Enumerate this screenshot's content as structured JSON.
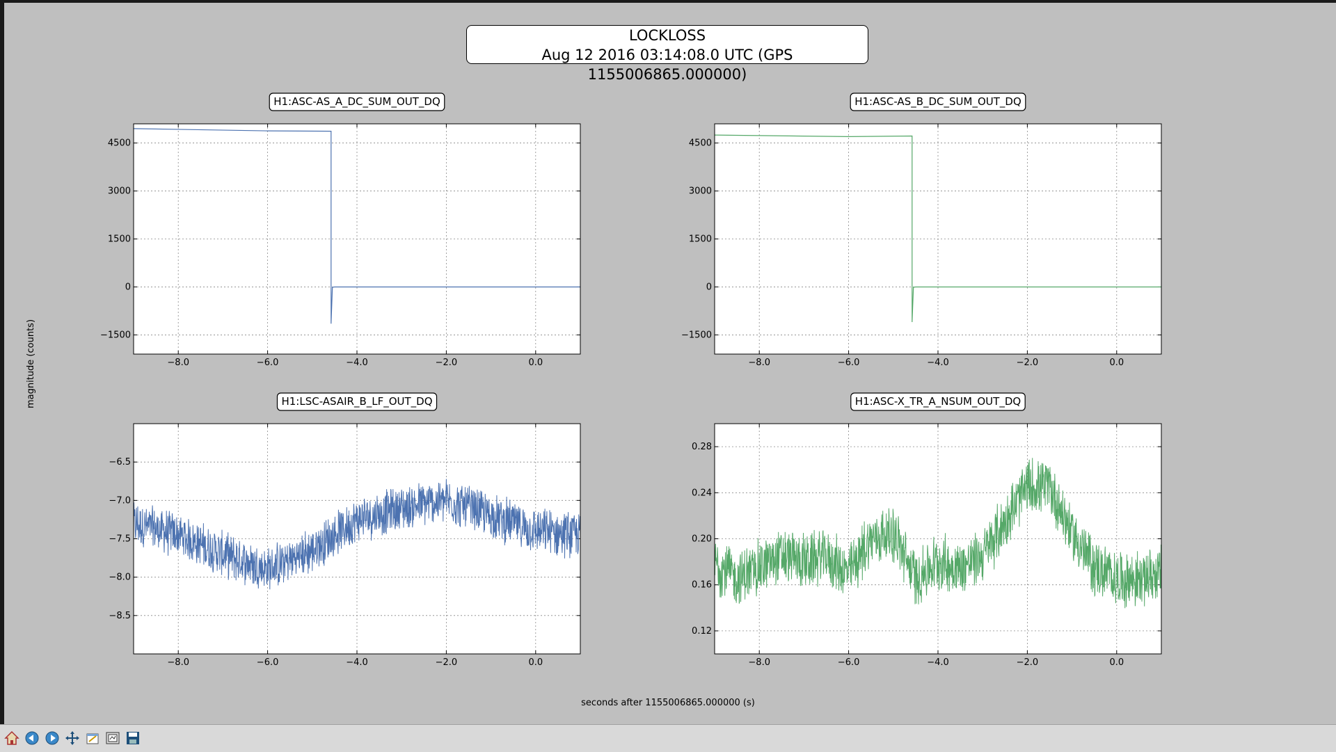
{
  "figure": {
    "title_line1": "LOCKLOSS",
    "title_line2": "Aug 12 2016 03:14:08.0 UTC (GPS 1155006865.000000)",
    "xlabel": "seconds after 1155006865.000000 (s)",
    "ylabel": "magnitude (counts)"
  },
  "toolbar": {
    "buttons": [
      "home-icon",
      "back-icon",
      "forward-icon",
      "pan-icon",
      "configure-icon",
      "subplots-icon",
      "save-icon"
    ]
  },
  "chart_data": [
    {
      "type": "line",
      "title": "H1:ASC-AS_A_DC_SUM_OUT_DQ",
      "color": "#4c72b0",
      "xlim": [
        -9,
        1
      ],
      "ylim": [
        -2100,
        5100
      ],
      "xticks": [
        -8,
        -6,
        -4,
        -2,
        0
      ],
      "xtick_labels": [
        "−8.0",
        "−6.0",
        "−4.0",
        "−2.0",
        "0.0"
      ],
      "yticks": [
        -1500,
        0,
        1500,
        3000,
        4500
      ],
      "ytick_labels": [
        "−1500",
        "0",
        "1500",
        "3000",
        "4500"
      ],
      "grid": true,
      "x": [
        -9.0,
        -6.0,
        -4.58,
        -4.58,
        -4.55,
        -4.5,
        1.0
      ],
      "y": [
        4950,
        4880,
        4870,
        -1150,
        -10,
        0,
        0
      ]
    },
    {
      "type": "line",
      "title": "H1:ASC-AS_B_DC_SUM_OUT_DQ",
      "color": "#55a868",
      "xlim": [
        -9,
        1
      ],
      "ylim": [
        -2100,
        5100
      ],
      "xticks": [
        -8,
        -6,
        -4,
        -2,
        0
      ],
      "xtick_labels": [
        "−8.0",
        "−6.0",
        "−4.0",
        "−2.0",
        "0.0"
      ],
      "yticks": [
        -1500,
        0,
        1500,
        3000,
        4500
      ],
      "ytick_labels": [
        "−1500",
        "0",
        "1500",
        "3000",
        "4500"
      ],
      "grid": true,
      "x": [
        -9.0,
        -6.0,
        -4.58,
        -4.58,
        -4.55,
        -4.5,
        1.0
      ],
      "y": [
        4750,
        4700,
        4720,
        -1100,
        -10,
        0,
        0
      ]
    },
    {
      "type": "line",
      "title": "H1:LSC-ASAIR_B_LF_OUT_DQ",
      "color": "#4c72b0",
      "xlim": [
        -9,
        1
      ],
      "ylim": [
        -9.0,
        -6.0
      ],
      "xticks": [
        -8,
        -6,
        -4,
        -2,
        0
      ],
      "xtick_labels": [
        "−8.0",
        "−6.0",
        "−4.0",
        "−2.0",
        "0.0"
      ],
      "yticks": [
        -8.5,
        -8.0,
        -7.5,
        -7.0,
        -6.5
      ],
      "ytick_labels": [
        "−8.5",
        "−8.0",
        "−7.5",
        "−7.0",
        "−6.5"
      ],
      "grid": true,
      "x": [
        -9.0,
        -8.0,
        -7.0,
        -6.0,
        -5.0,
        -4.0,
        -3.0,
        -2.0,
        -1.0,
        0.0,
        1.0
      ],
      "y": [
        -7.3,
        -7.45,
        -7.7,
        -7.9,
        -7.65,
        -7.25,
        -7.1,
        -7.0,
        -7.2,
        -7.4,
        -7.45
      ],
      "noise_amplitude": 0.33
    },
    {
      "type": "line",
      "title": "H1:ASC-X_TR_A_NSUM_OUT_DQ",
      "color": "#55a868",
      "xlim": [
        -9,
        1
      ],
      "ylim": [
        0.1,
        0.3
      ],
      "xticks": [
        -8,
        -6,
        -4,
        -2,
        0
      ],
      "xtick_labels": [
        "−8.0",
        "−6.0",
        "−4.0",
        "−2.0",
        "0.0"
      ],
      "yticks": [
        0.12,
        0.16,
        0.2,
        0.24,
        0.28
      ],
      "ytick_labels": [
        "0.12",
        "0.16",
        "0.20",
        "0.24",
        "0.28"
      ],
      "grid": true,
      "x": [
        -9.0,
        -8.5,
        -8.0,
        -7.5,
        -7.0,
        -6.5,
        -6.0,
        -5.5,
        -5.0,
        -4.5,
        -4.0,
        -3.5,
        -3.0,
        -2.5,
        -2.0,
        -1.5,
        -1.0,
        -0.5,
        0.0,
        0.5,
        1.0
      ],
      "y": [
        0.18,
        0.165,
        0.175,
        0.185,
        0.18,
        0.185,
        0.17,
        0.2,
        0.205,
        0.165,
        0.18,
        0.175,
        0.185,
        0.215,
        0.245,
        0.245,
        0.205,
        0.175,
        0.165,
        0.165,
        0.17
      ],
      "noise_amplitude": 0.028
    }
  ]
}
